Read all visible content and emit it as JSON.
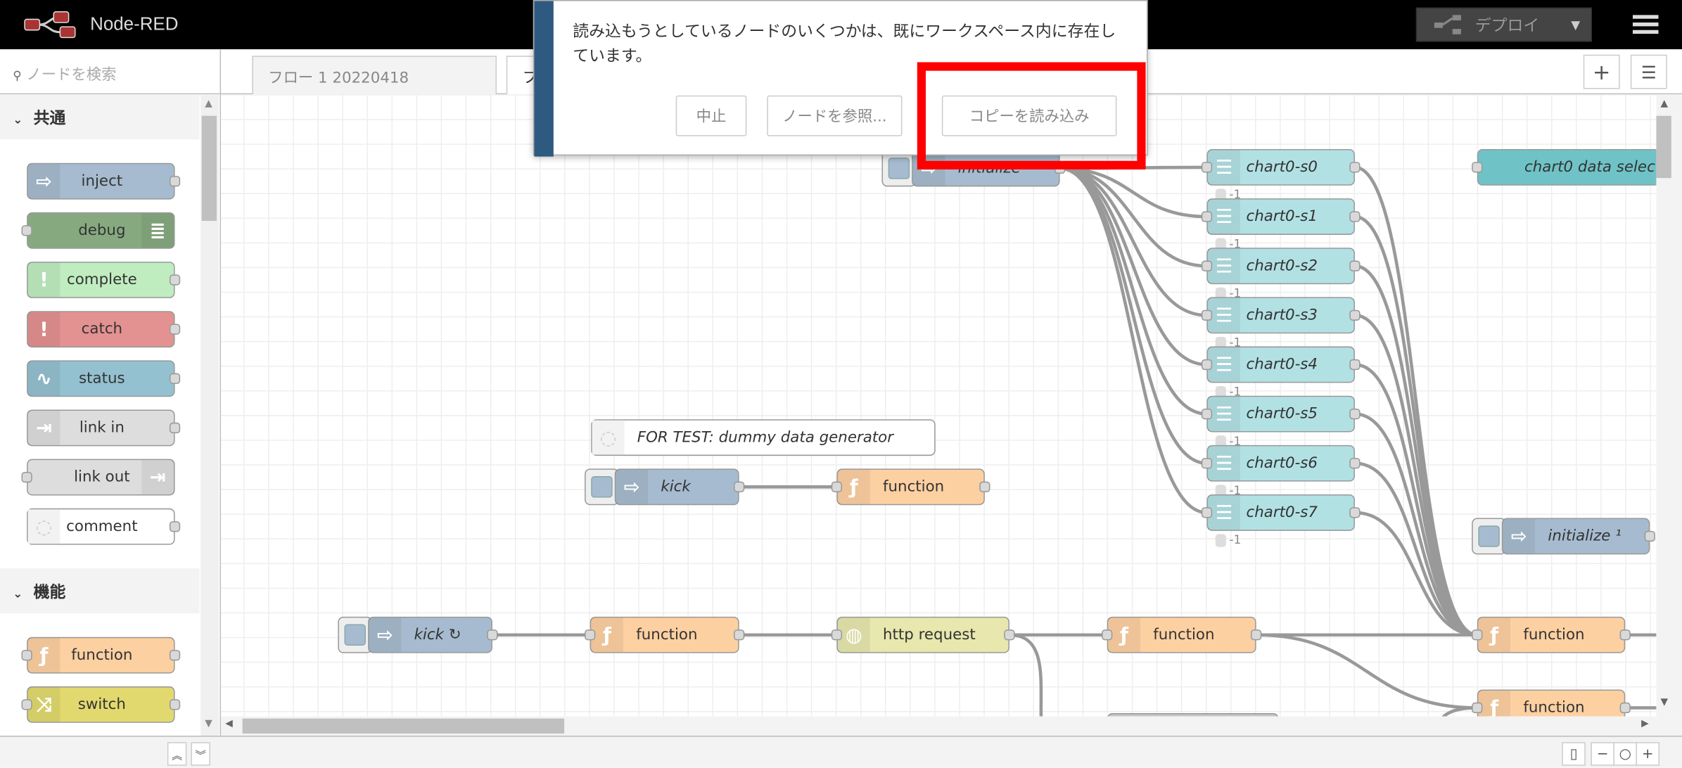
{
  "header": {
    "title": "Node-RED",
    "deploy_label": "デプロイ",
    "deploy_icon": "deploy-icon",
    "menu_icon": "hamburger-menu-icon"
  },
  "sidebar": {
    "search_placeholder": "ノードを検索",
    "sections": [
      {
        "label": "共通",
        "nodes": [
          {
            "label": "inject",
            "color": "#a6bbcf",
            "icon": "inject-arrow-icon"
          },
          {
            "label": "debug",
            "color": "#87a980",
            "icon": "debug-list-icon"
          },
          {
            "label": "complete",
            "color": "#c0edc0",
            "icon": "exclamation-icon"
          },
          {
            "label": "catch",
            "color": "#e49191",
            "icon": "exclamation-icon"
          },
          {
            "label": "status",
            "color": "#94c1d0",
            "icon": "pulse-icon"
          },
          {
            "label": "link in",
            "color": "#dddddd",
            "icon": "link-in-icon"
          },
          {
            "label": "link out",
            "color": "#dddddd",
            "icon": "link-out-icon"
          },
          {
            "label": "comment",
            "color": "#ffffff",
            "icon": "comment-icon"
          }
        ]
      },
      {
        "label": "機能",
        "nodes": [
          {
            "label": "function",
            "color": "#fdd0a2",
            "icon": "function-icon"
          },
          {
            "label": "switch",
            "color": "#e2d96e",
            "icon": "switch-icon"
          }
        ]
      }
    ]
  },
  "tabs": [
    {
      "label": "フロー 1 20220418"
    },
    {
      "label": "フ"
    }
  ],
  "tab_buttons": {
    "add_icon": "plus-icon",
    "list_icon": "list-icon"
  },
  "dialog": {
    "message": "読み込もうとしているノードのいくつかは、既にワークスペース内に存在しています。",
    "cancel": "中止",
    "view": "ノードを参照...",
    "import_copy": "コピーを読み込み",
    "highlight_color": "#ff0000"
  },
  "canvas": {
    "nodes": [
      {
        "label": "initialize",
        "type": "inject"
      },
      {
        "label": "chart0-s0",
        "type": "chart",
        "badge": "-1"
      },
      {
        "label": "chart0-s1",
        "type": "chart",
        "badge": "-1"
      },
      {
        "label": "chart0-s2",
        "type": "chart",
        "badge": "-1"
      },
      {
        "label": "chart0-s3",
        "type": "chart",
        "badge": "-1"
      },
      {
        "label": "chart0-s4",
        "type": "chart",
        "badge": "-1"
      },
      {
        "label": "chart0-s5",
        "type": "chart",
        "badge": "-1"
      },
      {
        "label": "chart0-s6",
        "type": "chart",
        "badge": "-1"
      },
      {
        "label": "chart0-s7",
        "type": "chart",
        "badge": "-1"
      },
      {
        "label": "chart0 data selec",
        "type": "dropdown"
      },
      {
        "label": "FOR TEST: dummy data generator",
        "type": "comment"
      },
      {
        "label": "kick",
        "type": "inject"
      },
      {
        "label": "function",
        "type": "function"
      },
      {
        "label": "initialize ¹",
        "type": "inject"
      },
      {
        "label": "kick ↻",
        "type": "inject"
      },
      {
        "label": "function",
        "type": "function"
      },
      {
        "label": "http request",
        "type": "http"
      },
      {
        "label": "function",
        "type": "function"
      },
      {
        "label": "function",
        "type": "function"
      },
      {
        "label": "function",
        "type": "function"
      }
    ]
  },
  "footer": {
    "map_icon": "map-icon",
    "zoom_out_icon": "minus-icon",
    "zoom_reset_icon": "circle-icon",
    "zoom_in_icon": "plus-icon",
    "collapse_icon": "chevron-up-double-icon",
    "expand_icon": "chevron-down-double-icon"
  }
}
